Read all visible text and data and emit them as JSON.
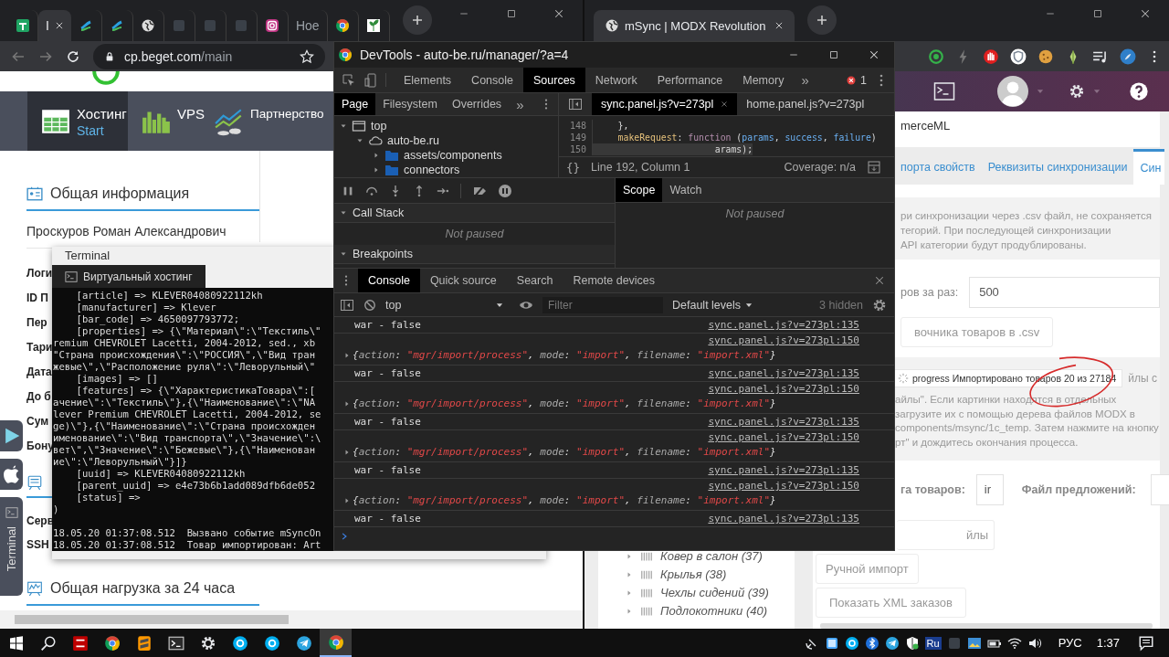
{
  "left_browser": {
    "tabs": [
      {
        "kind": "sheets",
        "selected": false
      },
      {
        "kind": "text",
        "label": "I",
        "selected": true
      },
      {
        "kind": "swoosh",
        "selected": false
      },
      {
        "kind": "swoosh",
        "selected": false
      },
      {
        "kind": "globe",
        "selected": false
      },
      {
        "kind": "square",
        "selected": false
      },
      {
        "kind": "square",
        "selected": false
      },
      {
        "kind": "square",
        "selected": false
      },
      {
        "kind": "camera",
        "selected": false
      },
      {
        "kind": "text",
        "label": "Ное",
        "selected": false
      },
      {
        "kind": "chrome",
        "selected": false
      },
      {
        "kind": "plant",
        "selected": false
      }
    ],
    "address": {
      "host": "cp.beget.com",
      "path": "/main"
    },
    "nav": [
      {
        "kind": "hosting",
        "title": "Хостинг",
        "subtitle": "Start",
        "selected": true
      },
      {
        "kind": "vps",
        "title": "VPS",
        "selected": false
      },
      {
        "kind": "partner",
        "title": "Партнерство",
        "selected": false
      }
    ],
    "section_title": "Общая информация",
    "owner": "Проскуров Роман Александрович",
    "fields": [
      "Логи",
      "ID П",
      "Пер",
      "Тари",
      "Дата",
      "До б",
      "Сум",
      "Бону"
    ],
    "server_fields": [
      "Серв",
      "SSH"
    ],
    "load_title": "Общая нагрузка за 24 часа",
    "dock": [
      {
        "kind": "play"
      },
      {
        "kind": "apple"
      },
      {
        "kind": "terminal",
        "label": "Terminal"
      }
    ]
  },
  "terminal": {
    "title": "Terminal",
    "tab": "Виртуальный хостинг",
    "dump_lines": [
      "    [article] => KLEVER04080922112kh",
      "    [manufacturer] => Klever",
      "    [bar_code] => 4650097793772;",
      "    [properties] => {\\\"Материал\\\":\\\"Текстиль\\\"",
      "remium CHEVROLET Lacetti, 2004-2012, sed., xb",
      "\"Страна происхождения\\\":\\\"РОССИЯ\\\",\\\"Вид тран",
      "жевые\\\",\\\"Расположение руля\\\":\\\"Леворульный\\\"",
      "    [images] => []",
      "    [features] => {\\\"ХарактеристикаТовара\\\":[",
      "ачение\\\":\\\"Текстиль\\\"},{\\\"Наименование\\\":\\\"NA",
      "lever Premium CHEVROLET Lacetti, 2004-2012, se",
      "ge)\\\"},{\\\"Наименование\\\":\\\"Страна происхожден",
      "именование\\\":\\\"Вид транспорта\\\",\\\"Значение\\\":\\",
      "вет\\\",\\\"Значение\\\":\\\"Бежевые\\\"},{\\\"Наименован",
      "ие\\\":\\\"Леворульный\\\"}]}",
      "    [uuid] => KLEVER04080922112kh",
      "    [parent_uuid] => e4e73b6b1add089dfb6de052",
      "    [status] =>",
      ")"
    ],
    "log_lines": [
      "18.05.20 01:37:08.512  Вызвано событие mSyncOn",
      "18.05.20 01:37:08.512  Товар импортирован: Art"
    ]
  },
  "devtools": {
    "title": "DevTools - auto-be.ru/manager/?a=4",
    "tabs": [
      {
        "label": "Elements",
        "selected": false
      },
      {
        "label": "Console",
        "selected": false
      },
      {
        "label": "Sources",
        "selected": true
      },
      {
        "label": "Network",
        "selected": false
      },
      {
        "label": "Performance",
        "selected": false
      },
      {
        "label": "Memory",
        "selected": false
      }
    ],
    "more": "»",
    "errors": "1",
    "nav_tabs": [
      {
        "label": "Page",
        "selected": true
      },
      {
        "label": "Filesystem",
        "selected": false
      },
      {
        "label": "Overrides",
        "selected": false
      }
    ],
    "tree": [
      {
        "kind": "frame",
        "label": "top",
        "expanded": true,
        "children": [
          {
            "kind": "domain",
            "label": "auto-be.ru",
            "expanded": true,
            "children": [
              {
                "kind": "folder",
                "label": "assets/components",
                "expanded": false
              },
              {
                "kind": "folder",
                "label": "connectors",
                "expanded": false
              }
            ]
          }
        ]
      }
    ],
    "editor_tabs": [
      {
        "label": "sync.panel.js?v=273pl",
        "selected": true
      },
      {
        "label": "home.panel.js?v=273pl",
        "selected": false
      }
    ],
    "code": [
      {
        "number": "148",
        "current": false,
        "tokens": [
          {
            "text": "    },",
            "kind": "plain"
          }
        ]
      },
      {
        "number": "149",
        "current": false,
        "tokens": [
          {
            "text": "    makeRequest",
            "kind": "prop"
          },
          {
            "text": ": ",
            "kind": "plain"
          },
          {
            "text": "function",
            "kind": "keyword"
          },
          {
            "text": " (",
            "kind": "plain"
          },
          {
            "text": "params",
            "kind": "param"
          },
          {
            "text": ", ",
            "kind": "plain"
          },
          {
            "text": "success",
            "kind": "param"
          },
          {
            "text": ", ",
            "kind": "plain"
          },
          {
            "text": "failure",
            "kind": "param"
          },
          {
            "text": ")",
            "kind": "plain"
          }
        ]
      },
      {
        "number": "150",
        "current": true,
        "tokens": [
          {
            "text": "                      arams);",
            "kind": "plain"
          }
        ]
      }
    ],
    "format_button": "{}",
    "position": "Line 192, Column 1",
    "coverage": "Coverage: n/a",
    "call_stack": {
      "title": "Call Stack",
      "status": "Not paused",
      "expanded": true
    },
    "breakpoints": {
      "title": "Breakpoints",
      "expanded": true
    },
    "scope_tabs": [
      {
        "label": "Scope",
        "selected": true
      },
      {
        "label": "Watch",
        "selected": false
      }
    ],
    "scope_status": "Not paused",
    "drawer_tabs": [
      {
        "label": "Console",
        "selected": true
      },
      {
        "label": "Quick source",
        "selected": false
      },
      {
        "label": "Search",
        "selected": false
      },
      {
        "label": "Remote devices",
        "selected": false
      }
    ],
    "context": "top",
    "filter": {
      "placeholder": "Filter"
    },
    "levels": "Default levels",
    "hidden": "3 hidden",
    "messages": [
      {
        "kind": "log",
        "text": "war - false",
        "source": "sync.panel.js?v=273pl:135"
      },
      {
        "kind": "object",
        "source": "sync.panel.js?v=273pl:150",
        "tokens": [
          {
            "text": "{",
            "kind": "plain"
          },
          {
            "text": "action",
            "kind": "key"
          },
          {
            "text": ": ",
            "kind": "plain"
          },
          {
            "text": "\"mgr/import/process\"",
            "kind": "string"
          },
          {
            "text": ", ",
            "kind": "plain"
          },
          {
            "text": "mode",
            "kind": "key"
          },
          {
            "text": ": ",
            "kind": "plain"
          },
          {
            "text": "\"import\"",
            "kind": "string"
          },
          {
            "text": ", ",
            "kind": "plain"
          },
          {
            "text": "filename",
            "kind": "key"
          },
          {
            "text": ": ",
            "kind": "plain"
          },
          {
            "text": "\"import.xml\"",
            "kind": "string"
          },
          {
            "text": "}",
            "kind": "plain"
          }
        ]
      },
      {
        "kind": "log",
        "text": "war - false",
        "source": "sync.panel.js?v=273pl:135"
      },
      {
        "kind": "object",
        "source": "sync.panel.js?v=273pl:150",
        "tokens": [
          {
            "text": "{",
            "kind": "plain"
          },
          {
            "text": "action",
            "kind": "key"
          },
          {
            "text": ": ",
            "kind": "plain"
          },
          {
            "text": "\"mgr/import/process\"",
            "kind": "string"
          },
          {
            "text": ", ",
            "kind": "plain"
          },
          {
            "text": "mode",
            "kind": "key"
          },
          {
            "text": ": ",
            "kind": "plain"
          },
          {
            "text": "\"import\"",
            "kind": "string"
          },
          {
            "text": ", ",
            "kind": "plain"
          },
          {
            "text": "filename",
            "kind": "key"
          },
          {
            "text": ": ",
            "kind": "plain"
          },
          {
            "text": "\"import.xml\"",
            "kind": "string"
          },
          {
            "text": "}",
            "kind": "plain"
          }
        ]
      },
      {
        "kind": "log",
        "text": "war - false",
        "source": "sync.panel.js?v=273pl:135"
      },
      {
        "kind": "object",
        "source": "sync.panel.js?v=273pl:150",
        "tokens": [
          {
            "text": "{",
            "kind": "plain"
          },
          {
            "text": "action",
            "kind": "key"
          },
          {
            "text": ": ",
            "kind": "plain"
          },
          {
            "text": "\"mgr/import/process\"",
            "kind": "string"
          },
          {
            "text": ", ",
            "kind": "plain"
          },
          {
            "text": "mode",
            "kind": "key"
          },
          {
            "text": ": ",
            "kind": "plain"
          },
          {
            "text": "\"import\"",
            "kind": "string"
          },
          {
            "text": ", ",
            "kind": "plain"
          },
          {
            "text": "filename",
            "kind": "key"
          },
          {
            "text": ": ",
            "kind": "plain"
          },
          {
            "text": "\"import.xml\"",
            "kind": "string"
          },
          {
            "text": "}",
            "kind": "plain"
          }
        ]
      },
      {
        "kind": "log",
        "text": "war - false",
        "source": "sync.panel.js?v=273pl:135"
      },
      {
        "kind": "object",
        "source": "sync.panel.js?v=273pl:150",
        "tokens": [
          {
            "text": "{",
            "kind": "plain"
          },
          {
            "text": "action",
            "kind": "key"
          },
          {
            "text": ": ",
            "kind": "plain"
          },
          {
            "text": "\"mgr/import/process\"",
            "kind": "string"
          },
          {
            "text": ", ",
            "kind": "plain"
          },
          {
            "text": "mode",
            "kind": "key"
          },
          {
            "text": ": ",
            "kind": "plain"
          },
          {
            "text": "\"import\"",
            "kind": "string"
          },
          {
            "text": ", ",
            "kind": "plain"
          },
          {
            "text": "filename",
            "kind": "key"
          },
          {
            "text": ": ",
            "kind": "plain"
          },
          {
            "text": "\"import.xml\"",
            "kind": "string"
          },
          {
            "text": "}",
            "kind": "plain"
          }
        ]
      },
      {
        "kind": "log",
        "text": "war - false",
        "source": "sync.panel.js?v=273pl:135"
      }
    ]
  },
  "right_browser": {
    "tab": "mSync | MODX Revolution",
    "extensions": [
      {
        "kind": "target"
      },
      {
        "kind": "bolt"
      },
      {
        "kind": "hand"
      },
      {
        "kind": "shield"
      },
      {
        "kind": "cookie"
      },
      {
        "kind": "leaf"
      },
      {
        "kind": "playlist"
      },
      {
        "kind": "profile"
      }
    ],
    "title_fragment": "merceML",
    "tabs": [
      {
        "label": "порта свойств",
        "selected": false
      },
      {
        "label": "Реквизиты синхронизации",
        "selected": false
      },
      {
        "label": "Син",
        "selected": true
      }
    ],
    "info_lines": [
      "ри синхронизации через .csv файл, не сохраняется",
      "тегорий. При последующей синхронизации",
      "API категории будут продублированы."
    ],
    "batch": {
      "label": "ров за раз:",
      "value": "500"
    },
    "csv_button": "вочника товаров в .csv",
    "progress": "progress Импортировано товаров 20 из 27184",
    "side_note": "йлы с",
    "help_lines": [
      "айлы\". Если картинки находятся в отдельных",
      "загрузите их с помощью дерева файлов MODX в",
      "components/msync/1c_temp. Затем нажмите на кнопку",
      "рт\" и дождитесь окончания процесса."
    ],
    "catalog": {
      "label": "га товаров:",
      "value": "ir"
    },
    "offers_label": "Файл предложений:",
    "buttons": [
      "йлы",
      "Ручной импорт",
      "Показать XML заказов"
    ],
    "tree": [
      {
        "label": "Ковер в салон (37)",
        "expanded": false
      },
      {
        "label": "Крылья (38)",
        "expanded": false
      },
      {
        "label": "Чехлы сидений (39)",
        "expanded": false
      },
      {
        "label": "Подлокотники (40)",
        "expanded": false
      }
    ]
  },
  "taskbar": {
    "apps": [
      {
        "kind": "search",
        "active": false
      },
      {
        "kind": "filezilla",
        "active": false
      },
      {
        "kind": "chrome",
        "active": false
      },
      {
        "kind": "sublime",
        "active": false
      },
      {
        "kind": "console",
        "active": false
      },
      {
        "kind": "gear",
        "active": false
      },
      {
        "kind": "bubble",
        "active": false
      },
      {
        "kind": "bubble",
        "active": false
      },
      {
        "kind": "telegram",
        "active": false
      },
      {
        "kind": "chrome",
        "active": true
      }
    ],
    "tray": [
      {
        "kind": "satellite"
      },
      {
        "kind": "appwin"
      },
      {
        "kind": "bubble"
      },
      {
        "kind": "bluetooth"
      },
      {
        "kind": "telegram"
      },
      {
        "kind": "shieldg"
      },
      {
        "kind": "badge",
        "label": "Ru"
      },
      {
        "kind": "square"
      },
      {
        "kind": "image"
      },
      {
        "kind": "battery"
      },
      {
        "kind": "wifi"
      },
      {
        "kind": "speaker"
      }
    ],
    "language": "РУС",
    "time": "1:37"
  }
}
